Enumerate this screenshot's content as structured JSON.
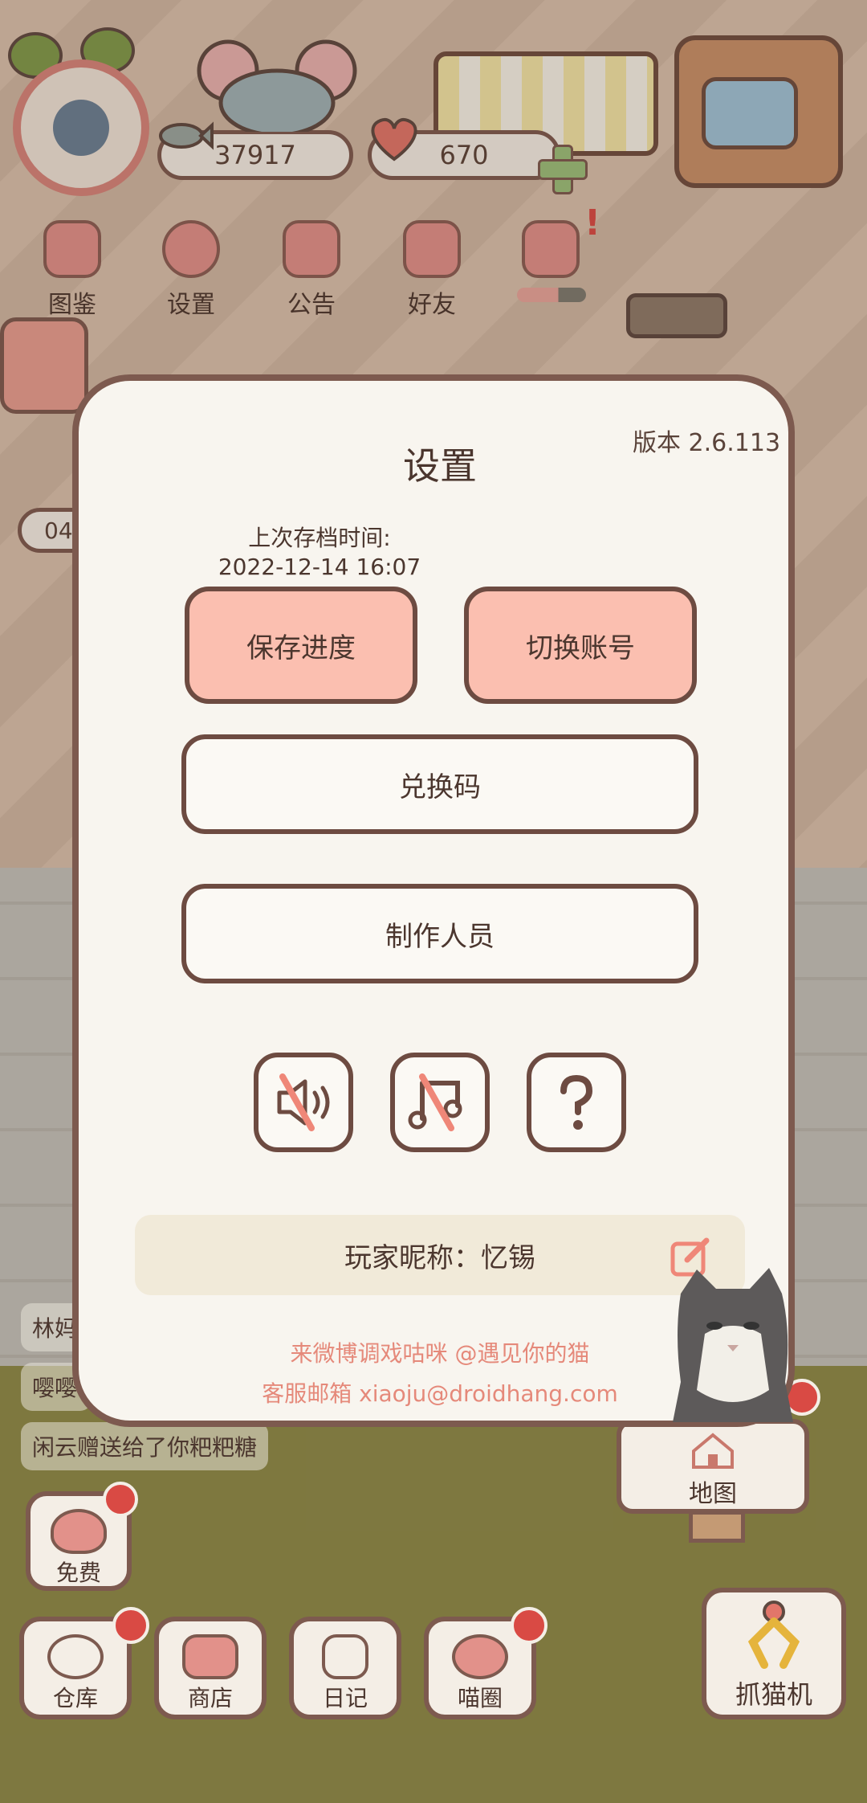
{
  "hud": {
    "coins": "37917",
    "hearts": "670",
    "nav": [
      {
        "label": "图鉴",
        "icon": "cat-face-icon"
      },
      {
        "label": "设置",
        "icon": "gear-icon"
      },
      {
        "label": "公告",
        "icon": "gift-icon"
      },
      {
        "label": "好友",
        "icon": "friends-icon"
      },
      {
        "label": "",
        "icon": "footprints-icon"
      }
    ],
    "side_partial": "04"
  },
  "settings": {
    "title": "设置",
    "version": "版本 2.6.113",
    "last_save_label": "上次存档时间:",
    "last_save_time": "2022-12-14 16:07",
    "save_button": "保存进度",
    "switch_account_button": "切换账号",
    "redeem_button": "兑换码",
    "credits_button": "制作人员",
    "icons": [
      "sound-muted-icon",
      "music-muted-icon",
      "help-icon"
    ],
    "nickname": "玩家昵称：忆锡",
    "weibo": "来微博调戏咕咪 @遇见你的猫",
    "email": "客服邮箱 xiaoju@droidhang.com"
  },
  "chat": [
    "林妈",
    "嘤嘤",
    "闲云赠送给了你粑粑糖"
  ],
  "bottom": {
    "free": "免费",
    "warehouse": "仓库",
    "shop": "商店",
    "diary": "日记",
    "circle": "喵圈",
    "map": "地图",
    "claw": "抓猫机"
  },
  "colors": {
    "modal_bg": "#f8f5ef",
    "border": "#7d5a4f",
    "pink_button": "#fbbfb0",
    "link": "#e5897a",
    "badge": "#d94a44"
  }
}
